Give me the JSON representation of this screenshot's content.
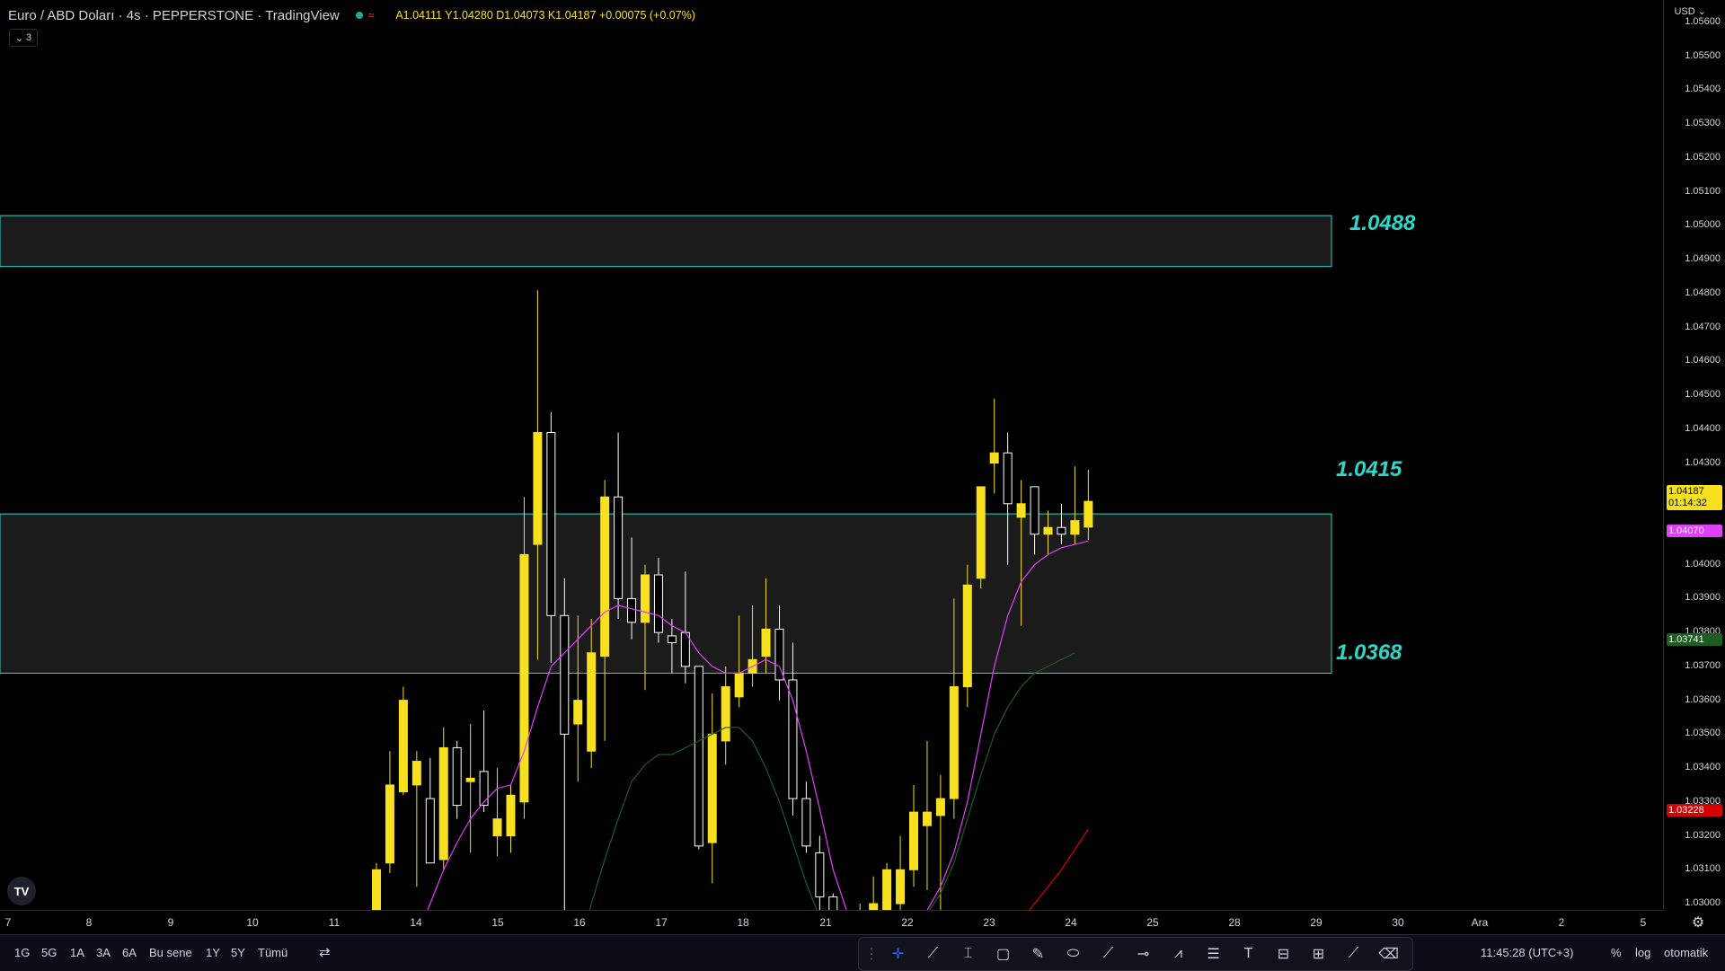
{
  "legend": {
    "title": "Euro / ABD Doları · 4s · PEPPERSTONE · TradingView",
    "ohlc": "A1.04111 Y1.04280 D1.04073 K1.04187 +0.00075 (+0.07%)"
  },
  "collapse_count": "3",
  "price_axis": {
    "currency": "USD",
    "ticks": [
      "1.05600",
      "1.05500",
      "1.05400",
      "1.05300",
      "1.05200",
      "1.05100",
      "1.05000",
      "1.04900",
      "1.04800",
      "1.04700",
      "1.04600",
      "1.04500",
      "1.04400",
      "1.04300",
      "1.04100",
      "1.04000",
      "1.03900",
      "1.03800",
      "1.03700",
      "1.03600",
      "1.03500",
      "1.03400",
      "1.03300",
      "1.03200",
      "1.03100",
      "1.03000"
    ],
    "last_price": "1.04187",
    "countdown": "01:14:32",
    "ma_fast_label": "1.04070",
    "ma_mid_label": "1.03741",
    "ma_slow_label": "1.03228"
  },
  "zones": [
    {
      "top_label": "1.0488",
      "top": 1.0503,
      "bottom": 1.0488
    },
    {
      "top_label": "1.0415",
      "bottom_label": "1.0368",
      "top": 1.0415,
      "bottom": 1.0368
    }
  ],
  "time_axis": [
    "7",
    "8",
    "9",
    "10",
    "11",
    "14",
    "15",
    "16",
    "17",
    "18",
    "21",
    "22",
    "23",
    "24",
    "25",
    "28",
    "29",
    "30",
    "Ara",
    "2",
    "5"
  ],
  "ranges": [
    "1G",
    "5G",
    "1A",
    "3A",
    "6A",
    "Bu sene",
    "1Y",
    "5Y",
    "Tümü"
  ],
  "clock": "11:45:28 (UTC+3)",
  "percent_label": "%",
  "log_label": "log",
  "auto_label": "otomatik",
  "colors": {
    "bull": "#f7e01d",
    "bear": "#000000",
    "zone_border": "#2ed6c8",
    "ma_fast": "#e040fb",
    "ma_mid": "#1b5e20",
    "ma_slow": "#d50000"
  },
  "chart_data": {
    "type": "candlestick",
    "candles": [
      {
        "o": 1.029,
        "h": 1.0312,
        "l": 1.029,
        "c": 1.031
      },
      {
        "o": 1.0312,
        "h": 1.0345,
        "l": 1.0309,
        "c": 1.0335
      },
      {
        "o": 1.0333,
        "h": 1.0364,
        "l": 1.0332,
        "c": 1.036
      },
      {
        "o": 1.0335,
        "h": 1.0345,
        "l": 1.0305,
        "c": 1.0342
      },
      {
        "o": 1.0331,
        "h": 1.0343,
        "l": 1.0312,
        "c": 1.0312
      },
      {
        "o": 1.0313,
        "h": 1.0352,
        "l": 1.031,
        "c": 1.0346
      },
      {
        "o": 1.0346,
        "h": 1.0348,
        "l": 1.0325,
        "c": 1.0329
      },
      {
        "o": 1.0336,
        "h": 1.0353,
        "l": 1.0315,
        "c": 1.0337
      },
      {
        "o": 1.0339,
        "h": 1.0357,
        "l": 1.0327,
        "c": 1.0329
      },
      {
        "o": 1.032,
        "h": 1.034,
        "l": 1.0314,
        "c": 1.0325
      },
      {
        "o": 1.032,
        "h": 1.0335,
        "l": 1.0315,
        "c": 1.0332
      },
      {
        "o": 1.033,
        "h": 1.042,
        "l": 1.0325,
        "c": 1.0403
      },
      {
        "o": 1.0406,
        "h": 1.0481,
        "l": 1.0372,
        "c": 1.0439
      },
      {
        "o": 1.0439,
        "h": 1.0445,
        "l": 1.0371,
        "c": 1.0385
      },
      {
        "o": 1.0385,
        "h": 1.0396,
        "l": 1.0287,
        "c": 1.035
      },
      {
        "o": 1.0353,
        "h": 1.0385,
        "l": 1.0336,
        "c": 1.036
      },
      {
        "o": 1.0345,
        "h": 1.0384,
        "l": 1.034,
        "c": 1.0374
      },
      {
        "o": 1.0373,
        "h": 1.0425,
        "l": 1.0348,
        "c": 1.042
      },
      {
        "o": 1.042,
        "h": 1.0439,
        "l": 1.0384,
        "c": 1.039
      },
      {
        "o": 1.039,
        "h": 1.0408,
        "l": 1.0378,
        "c": 1.0383
      },
      {
        "o": 1.0383,
        "h": 1.04,
        "l": 1.0363,
        "c": 1.0397
      },
      {
        "o": 1.0397,
        "h": 1.0402,
        "l": 1.0377,
        "c": 1.038
      },
      {
        "o": 1.0379,
        "h": 1.0384,
        "l": 1.0368,
        "c": 1.0377
      },
      {
        "o": 1.038,
        "h": 1.0398,
        "l": 1.0365,
        "c": 1.037
      },
      {
        "o": 1.037,
        "h": 1.037,
        "l": 1.0316,
        "c": 1.0317
      },
      {
        "o": 1.0318,
        "h": 1.0362,
        "l": 1.0306,
        "c": 1.035
      },
      {
        "o": 1.0348,
        "h": 1.037,
        "l": 1.0341,
        "c": 1.0364
      },
      {
        "o": 1.0361,
        "h": 1.0385,
        "l": 1.0358,
        "c": 1.0368
      },
      {
        "o": 1.0368,
        "h": 1.0388,
        "l": 1.0364,
        "c": 1.0372
      },
      {
        "o": 1.0373,
        "h": 1.0396,
        "l": 1.0368,
        "c": 1.0381
      },
      {
        "o": 1.0381,
        "h": 1.0388,
        "l": 1.036,
        "c": 1.0366
      },
      {
        "o": 1.0366,
        "h": 1.0377,
        "l": 1.0326,
        "c": 1.0331
      },
      {
        "o": 1.0331,
        "h": 1.0336,
        "l": 1.0315,
        "c": 1.0317
      },
      {
        "o": 1.0315,
        "h": 1.032,
        "l": 1.0295,
        "c": 1.0302
      },
      {
        "o": 1.0302,
        "h": 1.0303,
        "l": 1.027,
        "c": 1.0276
      },
      {
        "o": 1.027,
        "h": 1.0286,
        "l": 1.026,
        "c": 1.028
      },
      {
        "o": 1.0282,
        "h": 1.03,
        "l": 1.0278,
        "c": 1.0298
      },
      {
        "o": 1.0298,
        "h": 1.0308,
        "l": 1.029,
        "c": 1.03
      },
      {
        "o": 1.0298,
        "h": 1.0312,
        "l": 1.0275,
        "c": 1.031
      },
      {
        "o": 1.03,
        "h": 1.032,
        "l": 1.0295,
        "c": 1.031
      },
      {
        "o": 1.031,
        "h": 1.0335,
        "l": 1.0305,
        "c": 1.0327
      },
      {
        "o": 1.0323,
        "h": 1.0348,
        "l": 1.0304,
        "c": 1.0327
      },
      {
        "o": 1.0326,
        "h": 1.0338,
        "l": 1.0297,
        "c": 1.0331
      },
      {
        "o": 1.0331,
        "h": 1.039,
        "l": 1.0325,
        "c": 1.0364
      },
      {
        "o": 1.0364,
        "h": 1.04,
        "l": 1.0358,
        "c": 1.0394
      },
      {
        "o": 1.0396,
        "h": 1.0423,
        "l": 1.0393,
        "c": 1.0423
      },
      {
        "o": 1.043,
        "h": 1.0449,
        "l": 1.0421,
        "c": 1.0433
      },
      {
        "o": 1.0433,
        "h": 1.0439,
        "l": 1.04,
        "c": 1.0418
      },
      {
        "o": 1.0414,
        "h": 1.0425,
        "l": 1.0382,
        "c": 1.0418
      },
      {
        "o": 1.0423,
        "h": 1.0423,
        "l": 1.0403,
        "c": 1.0409
      },
      {
        "o": 1.0409,
        "h": 1.0416,
        "l": 1.0403,
        "c": 1.0411
      },
      {
        "o": 1.0411,
        "h": 1.0418,
        "l": 1.0406,
        "c": 1.0409
      },
      {
        "o": 1.0409,
        "h": 1.0429,
        "l": 1.0406,
        "c": 1.0413
      },
      {
        "o": 1.04111,
        "h": 1.0428,
        "l": 1.04073,
        "c": 1.04187
      }
    ],
    "ma_fast": [
      null,
      null,
      null,
      1.029,
      1.03,
      1.031,
      1.0318,
      1.0325,
      1.033,
      1.0334,
      1.0335,
      1.0345,
      1.0358,
      1.037,
      1.0374,
      1.0378,
      1.0382,
      1.0386,
      1.0388,
      1.0387,
      1.0386,
      1.0385,
      1.0382,
      1.038,
      1.0374,
      1.037,
      1.0368,
      1.0368,
      1.037,
      1.0372,
      1.037,
      1.036,
      1.0345,
      1.0328,
      1.031,
      1.0298,
      1.029,
      1.0285,
      1.0285,
      1.0287,
      1.0292,
      1.0298,
      1.0305,
      1.0315,
      1.033,
      1.035,
      1.037,
      1.0385,
      1.0395,
      1.04,
      1.0403,
      1.0405,
      1.0406,
      1.0407
    ],
    "ma_mid": [
      null,
      null,
      null,
      null,
      null,
      null,
      null,
      null,
      null,
      null,
      null,
      null,
      null,
      null,
      1.027,
      1.0285,
      1.03,
      1.0313,
      1.0325,
      1.0336,
      1.0341,
      1.0344,
      1.0344,
      1.0346,
      1.0348,
      1.035,
      1.0352,
      1.0352,
      1.0348,
      1.034,
      1.033,
      1.0318,
      1.0306,
      1.0296,
      1.029,
      1.0286,
      1.0285,
      1.0285,
      1.0286,
      1.0288,
      1.0292,
      1.0297,
      1.0303,
      1.0312,
      1.0325,
      1.0338,
      1.035,
      1.0358,
      1.0364,
      1.0368,
      1.037,
      1.0372,
      1.0374
    ],
    "ma_slow": [
      null,
      null,
      null,
      null,
      null,
      null,
      null,
      null,
      null,
      null,
      null,
      null,
      null,
      null,
      null,
      null,
      null,
      null,
      null,
      null,
      null,
      null,
      null,
      null,
      null,
      null,
      null,
      null,
      null,
      null,
      null,
      null,
      null,
      null,
      null,
      null,
      null,
      null,
      null,
      null,
      null,
      null,
      null,
      null,
      null,
      null,
      null,
      null,
      1.0295,
      1.03,
      1.0305,
      1.031,
      1.0316,
      1.0322
    ],
    "ylim": [
      1.0296,
      1.0565
    ]
  }
}
